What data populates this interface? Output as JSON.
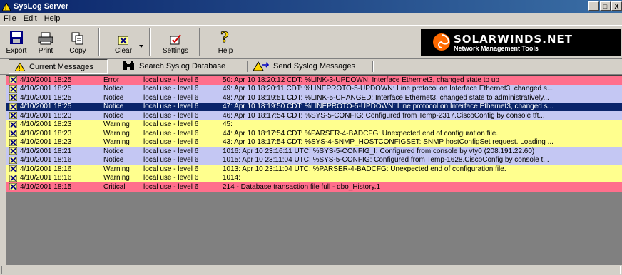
{
  "window": {
    "title": "SysLog Server",
    "buttons": [
      "_",
      "□",
      "X"
    ]
  },
  "menu": [
    "File",
    "Edit",
    "Help"
  ],
  "toolbar": {
    "export": "Export",
    "print": "Print",
    "copy": "Copy",
    "clear": "Clear",
    "settings": "Settings",
    "help": "Help"
  },
  "logo": {
    "brand": "SOLARWINDS.NET",
    "tagline": "Network Management Tools"
  },
  "tabs": {
    "current": "Current Messages",
    "search": "Search Syslog Database",
    "send": "Send Syslog Messages"
  },
  "messages": [
    {
      "date": "4/10/2001 18:25",
      "severity": "Error",
      "facility": "local use - level 6",
      "message": "50: Apr 10 18:20:12 CDT: %LINK-3-UPDOWN: Interface Ethernet3, changed state to up",
      "kind": "err"
    },
    {
      "date": "4/10/2001 18:25",
      "severity": "Notice",
      "facility": "local use - level 6",
      "message": "49: Apr 10 18:20:11 CDT: %LINEPROTO-5-UPDOWN: Line protocol on Interface Ethernet3, changed s...",
      "kind": "notice"
    },
    {
      "date": "4/10/2001 18:25",
      "severity": "Notice",
      "facility": "local use - level 6",
      "message": "48: Apr 10 18:19:51 CDT: %LINK-5-CHANGED: Interface Ethernet3, changed state to administratively...",
      "kind": "notice"
    },
    {
      "date": "4/10/2001 18:25",
      "severity": "Notice",
      "facility": "local use - level 6",
      "message": "47: Apr 10 18:19:50 CDT: %LINEPROTO-5-UPDOWN: Line protocol on Interface Ethernet3, changed s...",
      "kind": "sel"
    },
    {
      "date": "4/10/2001 18:23",
      "severity": "Notice",
      "facility": "local use - level 6",
      "message": "46: Apr 10 18:17:54 CDT: %SYS-5-CONFIG: Configured from Temp-2317.CiscoConfig by console tft...",
      "kind": "notice"
    },
    {
      "date": "4/10/2001 18:23",
      "severity": "Warning",
      "facility": "local use - level 6",
      "message": "45:",
      "kind": "warn"
    },
    {
      "date": "4/10/2001 18:23",
      "severity": "Warning",
      "facility": "local use - level 6",
      "message": "44: Apr 10 18:17:54 CDT: %PARSER-4-BADCFG: Unexpected end of configuration file.",
      "kind": "warn"
    },
    {
      "date": "4/10/2001 18:23",
      "severity": "Warning",
      "facility": "local use - level 6",
      "message": "43: Apr 10 18:17:54 CDT: %SYS-4-SNMP_HOSTCONFIGSET: SNMP hostConfigSet request.  Loading ...",
      "kind": "warn"
    },
    {
      "date": "4/10/2001 18:21",
      "severity": "Notice",
      "facility": "local use - level 6",
      "message": "1016: Apr 10 23:16:11 UTC: %SYS-5-CONFIG_I: Configured from console by vty0 (208.191.22.60)",
      "kind": "notice"
    },
    {
      "date": "4/10/2001 18:16",
      "severity": "Notice",
      "facility": "local use - level 6",
      "message": "1015: Apr 10 23:11:04 UTC: %SYS-5-CONFIG: Configured from Temp-1628.CiscoConfig by console t...",
      "kind": "notice"
    },
    {
      "date": "4/10/2001 18:16",
      "severity": "Warning",
      "facility": "local use - level 6",
      "message": "1013: Apr 10 23:11:04 UTC: %PARSER-4-BADCFG: Unexpected end of configuration file.",
      "kind": "warn"
    },
    {
      "date": "4/10/2001 18:16",
      "severity": "Warning",
      "facility": "local use - level 6",
      "message": "1014:",
      "kind": "warn"
    },
    {
      "date": "4/10/2001 18:15",
      "severity": "Critical",
      "facility": "local use - level 6",
      "message": " 214 - Database transaction file full - dbo_History.1",
      "kind": "crit"
    }
  ],
  "colors": {
    "error_row": "#ff6f8c",
    "notice_row": "#c4c7f3",
    "warning_row": "#ffff8e",
    "selected_row": "#0a246a"
  }
}
